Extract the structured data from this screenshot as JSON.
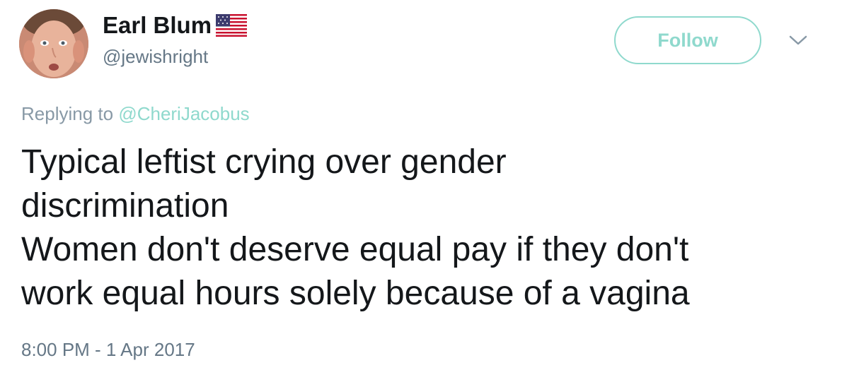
{
  "author": {
    "display_name": "Earl Blum",
    "handle": "@jewishright",
    "flag_icon": "us-flag-icon"
  },
  "follow_button": {
    "label": "Follow",
    "color": "#8fd9cd"
  },
  "more_menu_icon": "chevron-down-icon",
  "reply_context": {
    "prefix": "Replying to",
    "mention": "@CheriJacobus"
  },
  "tweet": {
    "lines": [
      "Typical leftist crying over gender",
      "discrimination",
      "Women don't deserve equal pay if they don't",
      "work equal hours solely because of a vagina"
    ],
    "timestamp": "8:00 PM - 1 Apr 2017"
  },
  "colors": {
    "accent": "#8fd9cd",
    "muted_text": "#657786",
    "body_text": "#14171a"
  }
}
